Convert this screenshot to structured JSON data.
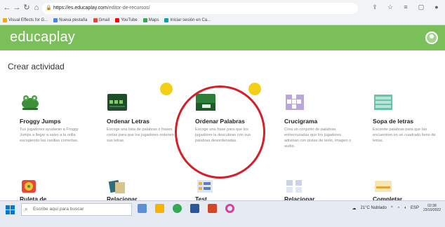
{
  "browser": {
    "url_host": "https://es.educaplay.com",
    "url_path": "/editor-de-recursos/",
    "bookmarks": [
      {
        "label": "Visual Effects for G..."
      },
      {
        "label": "Nueva pestaña"
      },
      {
        "label": "Gmail"
      },
      {
        "label": "YouTube"
      },
      {
        "label": "Maps"
      },
      {
        "label": "Iniciar sesión en Ca..."
      }
    ]
  },
  "app": {
    "logo": "educaplay"
  },
  "main": {
    "title": "Crear actividad",
    "cards": [
      {
        "title": "Froggy Jumps",
        "desc": "Tus jugadores ayudarán a Froggy Jumps a llegar a salvo a la orilla escogiendo las casillas correctas."
      },
      {
        "title": "Ordenar Letras",
        "desc": "Escoge una lista de palabras o frases cortas para que los jugadores ordenen sus letras."
      },
      {
        "title": "Ordenar Palabras",
        "desc": "Escoge una frase para que los jugadores la descubran con sus palabras desordenadas."
      },
      {
        "title": "Crucigrama",
        "desc": "Crea un conjunto de palabras entrecruzadas que los jugadores adivinan con pistas de texto, imagen o audio."
      },
      {
        "title": "Sopa de letras",
        "desc": "Esconde palabras para que las encuentren en un cuadrado lleno de letras."
      }
    ],
    "cards_row2": [
      {
        "title": "Ruleta de"
      },
      {
        "title": "Relacionar"
      },
      {
        "title": "Test"
      },
      {
        "title": "Relacionar"
      },
      {
        "title": "Completar"
      }
    ]
  },
  "taskbar": {
    "search_placeholder": "Escribe aquí para buscar",
    "weather": "21°C Nublado",
    "lang": "ESP",
    "time": "02:38",
    "date": "23/10/2022"
  },
  "colors": {
    "brand": "#7bbf5a",
    "highlight_circle": "#d61f26",
    "badge": "#f3d017"
  }
}
